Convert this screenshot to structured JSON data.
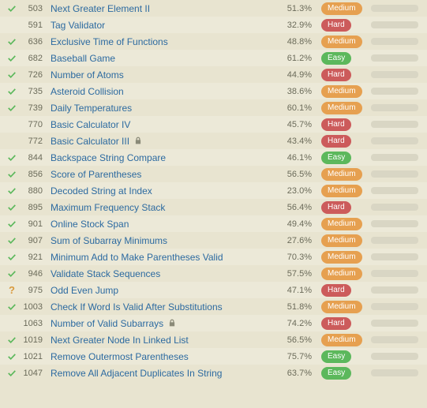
{
  "difficulty_labels": {
    "easy": "Easy",
    "medium": "Medium",
    "hard": "Hard"
  },
  "problems": [
    {
      "solved": true,
      "attempted": false,
      "num": 503,
      "title": "Next Greater Element II",
      "locked": false,
      "acceptance": "51.3%",
      "difficulty": "medium",
      "freq": 0
    },
    {
      "solved": false,
      "attempted": false,
      "num": 591,
      "title": "Tag Validator",
      "locked": false,
      "acceptance": "32.9%",
      "difficulty": "hard",
      "freq": 0
    },
    {
      "solved": true,
      "attempted": false,
      "num": 636,
      "title": "Exclusive Time of Functions",
      "locked": false,
      "acceptance": "48.8%",
      "difficulty": "medium",
      "freq": 0
    },
    {
      "solved": true,
      "attempted": false,
      "num": 682,
      "title": "Baseball Game",
      "locked": false,
      "acceptance": "61.2%",
      "difficulty": "easy",
      "freq": 0
    },
    {
      "solved": true,
      "attempted": false,
      "num": 726,
      "title": "Number of Atoms",
      "locked": false,
      "acceptance": "44.9%",
      "difficulty": "hard",
      "freq": 0
    },
    {
      "solved": true,
      "attempted": false,
      "num": 735,
      "title": "Asteroid Collision",
      "locked": false,
      "acceptance": "38.6%",
      "difficulty": "medium",
      "freq": 0
    },
    {
      "solved": true,
      "attempted": false,
      "num": 739,
      "title": "Daily Temperatures",
      "locked": false,
      "acceptance": "60.1%",
      "difficulty": "medium",
      "freq": 0
    },
    {
      "solved": false,
      "attempted": false,
      "num": 770,
      "title": "Basic Calculator IV",
      "locked": false,
      "acceptance": "45.7%",
      "difficulty": "hard",
      "freq": 0
    },
    {
      "solved": false,
      "attempted": false,
      "num": 772,
      "title": "Basic Calculator III",
      "locked": true,
      "acceptance": "43.4%",
      "difficulty": "hard",
      "freq": 0
    },
    {
      "solved": true,
      "attempted": false,
      "num": 844,
      "title": "Backspace String Compare",
      "locked": false,
      "acceptance": "46.1%",
      "difficulty": "easy",
      "freq": 0
    },
    {
      "solved": true,
      "attempted": false,
      "num": 856,
      "title": "Score of Parentheses",
      "locked": false,
      "acceptance": "56.5%",
      "difficulty": "medium",
      "freq": 0
    },
    {
      "solved": true,
      "attempted": false,
      "num": 880,
      "title": "Decoded String at Index",
      "locked": false,
      "acceptance": "23.0%",
      "difficulty": "medium",
      "freq": 0
    },
    {
      "solved": true,
      "attempted": false,
      "num": 895,
      "title": "Maximum Frequency Stack",
      "locked": false,
      "acceptance": "56.4%",
      "difficulty": "hard",
      "freq": 0
    },
    {
      "solved": true,
      "attempted": false,
      "num": 901,
      "title": "Online Stock Span",
      "locked": false,
      "acceptance": "49.4%",
      "difficulty": "medium",
      "freq": 0
    },
    {
      "solved": true,
      "attempted": false,
      "num": 907,
      "title": "Sum of Subarray Minimums",
      "locked": false,
      "acceptance": "27.6%",
      "difficulty": "medium",
      "freq": 0
    },
    {
      "solved": true,
      "attempted": false,
      "num": 921,
      "title": "Minimum Add to Make Parentheses Valid",
      "locked": false,
      "acceptance": "70.3%",
      "difficulty": "medium",
      "freq": 0
    },
    {
      "solved": true,
      "attempted": false,
      "num": 946,
      "title": "Validate Stack Sequences",
      "locked": false,
      "acceptance": "57.5%",
      "difficulty": "medium",
      "freq": 0
    },
    {
      "solved": false,
      "attempted": true,
      "num": 975,
      "title": "Odd Even Jump",
      "locked": false,
      "acceptance": "47.1%",
      "difficulty": "hard",
      "freq": 0
    },
    {
      "solved": true,
      "attempted": false,
      "num": 1003,
      "title": "Check If Word Is Valid After Substitutions",
      "locked": false,
      "acceptance": "51.8%",
      "difficulty": "medium",
      "freq": 0
    },
    {
      "solved": false,
      "attempted": false,
      "num": 1063,
      "title": "Number of Valid Subarrays",
      "locked": true,
      "acceptance": "74.2%",
      "difficulty": "hard",
      "freq": 0
    },
    {
      "solved": true,
      "attempted": false,
      "num": 1019,
      "title": "Next Greater Node In Linked List",
      "locked": false,
      "acceptance": "56.5%",
      "difficulty": "medium",
      "freq": 0
    },
    {
      "solved": true,
      "attempted": false,
      "num": 1021,
      "title": "Remove Outermost Parentheses",
      "locked": false,
      "acceptance": "75.7%",
      "difficulty": "easy",
      "freq": 0
    },
    {
      "solved": true,
      "attempted": false,
      "num": 1047,
      "title": "Remove All Adjacent Duplicates In String",
      "locked": false,
      "acceptance": "63.7%",
      "difficulty": "easy",
      "freq": 0
    }
  ]
}
